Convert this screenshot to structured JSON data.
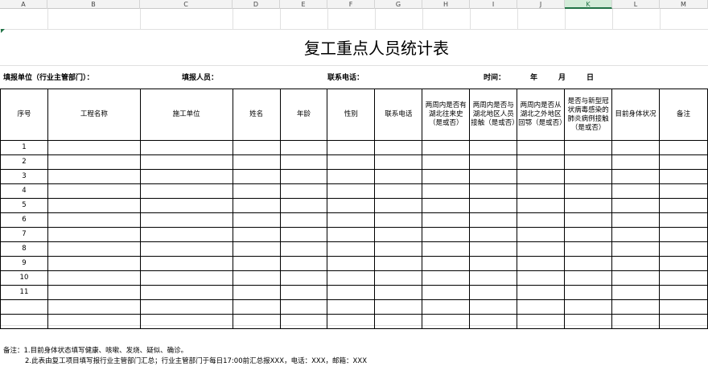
{
  "sheet": {
    "columns": [
      "A",
      "B",
      "C",
      "D",
      "E",
      "F",
      "G",
      "H",
      "I",
      "J",
      "K",
      "L",
      "M"
    ],
    "selected_column": "K"
  },
  "title": "复工重点人员统计表",
  "info": {
    "unit_label": "填报单位（行业主管部门）：",
    "filler_label": "填报人员：",
    "phone_label": "联系电话：",
    "time_label": "时间：",
    "year": "年",
    "month": "月",
    "day": "日"
  },
  "table": {
    "headers": [
      "序号",
      "工程名称",
      "施工单位",
      "姓名",
      "年龄",
      "性别",
      "联系电话",
      "两周内是否有湖北往来史（是或否）",
      "两周内是否与湖北地区人员接触（是或否）",
      "两周内是否从湖北之外地区回鄂（是或否）",
      "是否与新型冠状病毒感染的肺炎病例接触（是或否）",
      "目前身体状况",
      "备注"
    ],
    "row_numbers": [
      "1",
      "2",
      "3",
      "4",
      "5",
      "6",
      "7",
      "8",
      "9",
      "10",
      "11",
      "",
      ""
    ]
  },
  "notes": {
    "line1": "备注：1.目前身体状态填写健康、咳嗽、发烧、疑似、确诊。",
    "line2": "2.此表由复工项目填写报行业主管部门汇总；行业主管部门于每日17:00前汇总报XXX，电话：XXX，邮箱：XXX"
  }
}
